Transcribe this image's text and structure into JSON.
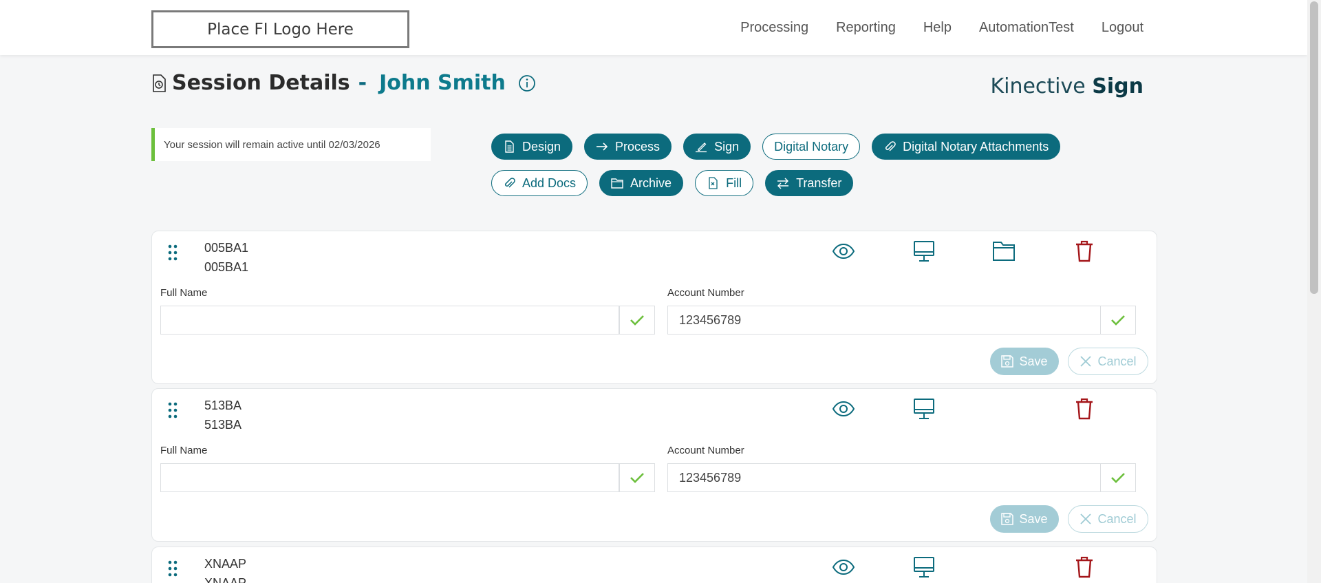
{
  "header": {
    "logo_text": "Place FI Logo Here",
    "nav": [
      "Processing",
      "Reporting",
      "Help",
      "AutomationTest",
      "Logout"
    ]
  },
  "page": {
    "title": "Session Details",
    "separator": "-",
    "signer_name": "John Smith",
    "brand_light": "Kinective",
    "brand_bold": "Sign",
    "session_notice": "Your session will remain active until 02/03/2026"
  },
  "actions": {
    "row1": [
      {
        "label": "Design",
        "icon": "document-icon",
        "style": "solid"
      },
      {
        "label": "Process",
        "icon": "arrow-right-icon",
        "style": "solid"
      },
      {
        "label": "Sign",
        "icon": "pen-icon",
        "style": "solid"
      },
      {
        "label": "Digital Notary",
        "icon": "",
        "style": "outline"
      },
      {
        "label": "Digital Notary Attachments",
        "icon": "paperclip-icon",
        "style": "solid"
      }
    ],
    "row2": [
      {
        "label": "Add Docs",
        "icon": "paperclip-icon",
        "style": "outline"
      },
      {
        "label": "Archive",
        "icon": "folder-icon",
        "style": "solid"
      },
      {
        "label": "Fill",
        "icon": "doc-x-icon",
        "style": "outline"
      },
      {
        "label": "Transfer",
        "icon": "transfer-icon",
        "style": "solid"
      }
    ]
  },
  "documents": [
    {
      "code1": "005BA1",
      "code2": "005BA1",
      "full_name_label": "Full Name",
      "full_name_value": "",
      "account_label": "Account Number",
      "account_value": "123456789",
      "save_label": "Save",
      "cancel_label": "Cancel"
    },
    {
      "code1": "513BA",
      "code2": "513BA",
      "full_name_label": "Full Name",
      "full_name_value": "",
      "account_label": "Account Number",
      "account_value": "123456789",
      "save_label": "Save",
      "cancel_label": "Cancel"
    },
    {
      "code1": "XNAAP",
      "code2": "XNAAP"
    }
  ],
  "colors": {
    "primary": "#0c6b7d",
    "name_accent": "#0d7a8c",
    "check_green": "#6cbf3c",
    "trash_red": "#a4161a",
    "save_disabled": "#a3ccd6"
  }
}
